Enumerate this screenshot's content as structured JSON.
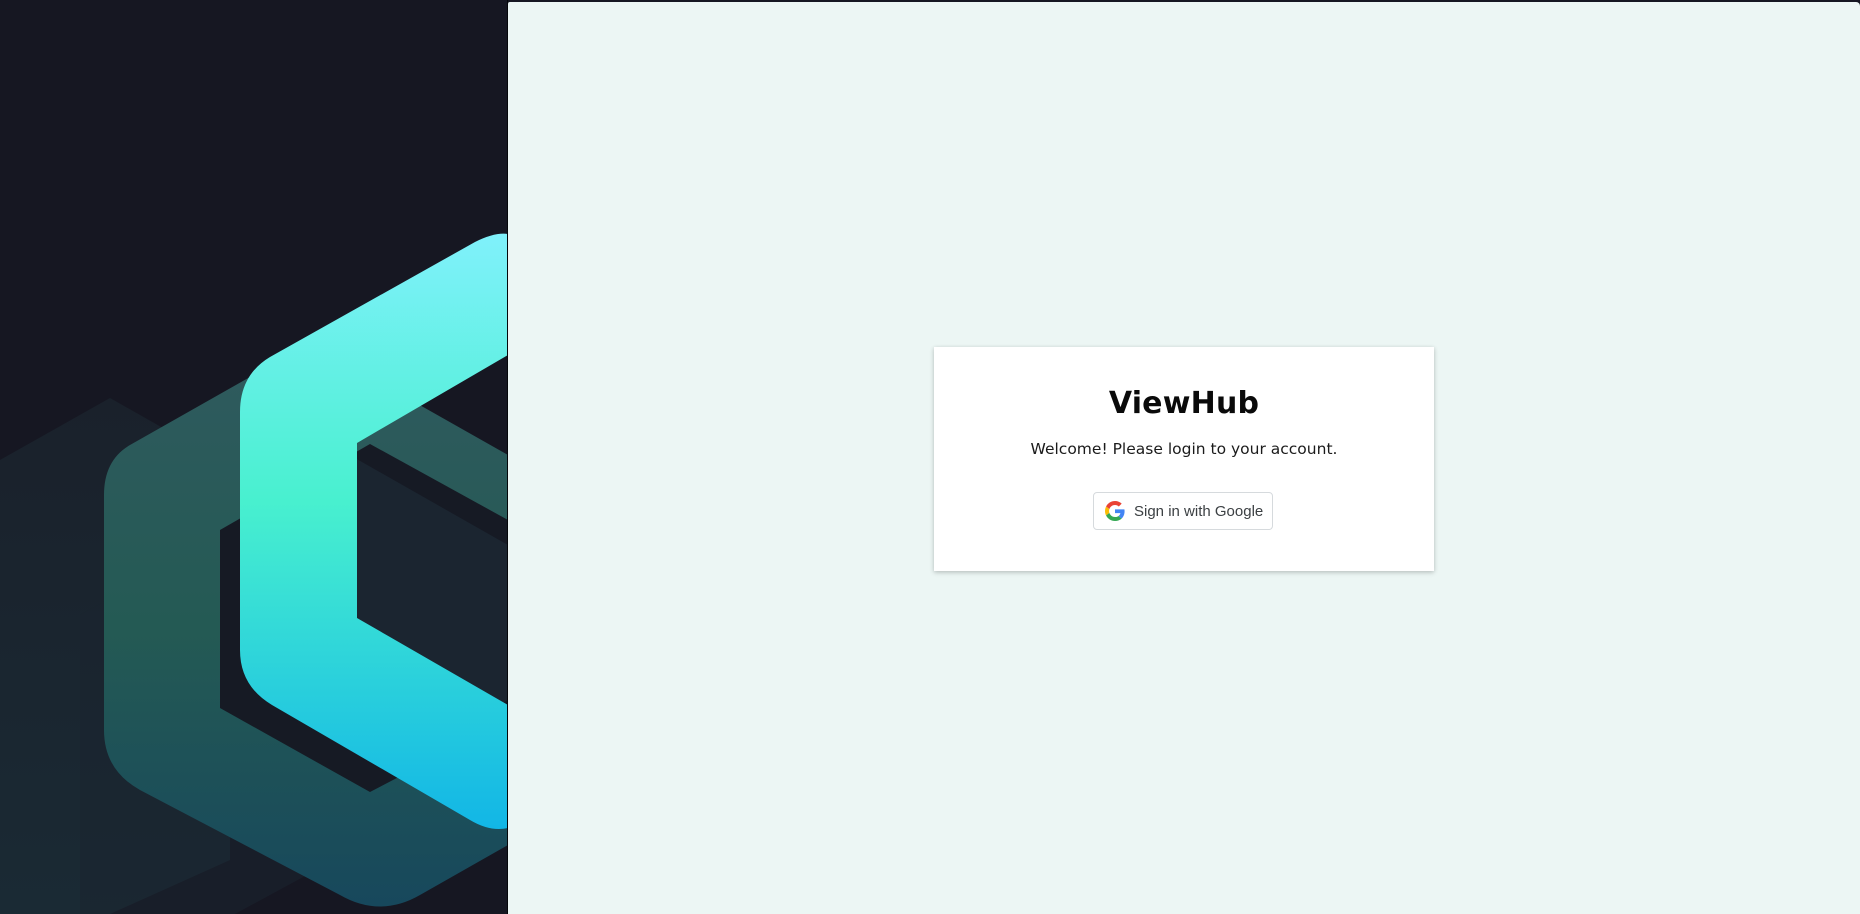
{
  "app": {
    "title": "ViewHub",
    "welcome_text": "Welcome! Please login to your account."
  },
  "login": {
    "google_button_label": "Sign in with Google",
    "google_icon": "google-g-icon"
  },
  "brand_colors": {
    "left_background": "#161722",
    "right_background": "#ecf6f4",
    "gradient_top": "#7df0fb",
    "gradient_mid": "#47efcf",
    "gradient_bottom": "#14b3e6",
    "shadow_hex": "#2f5c5f"
  }
}
